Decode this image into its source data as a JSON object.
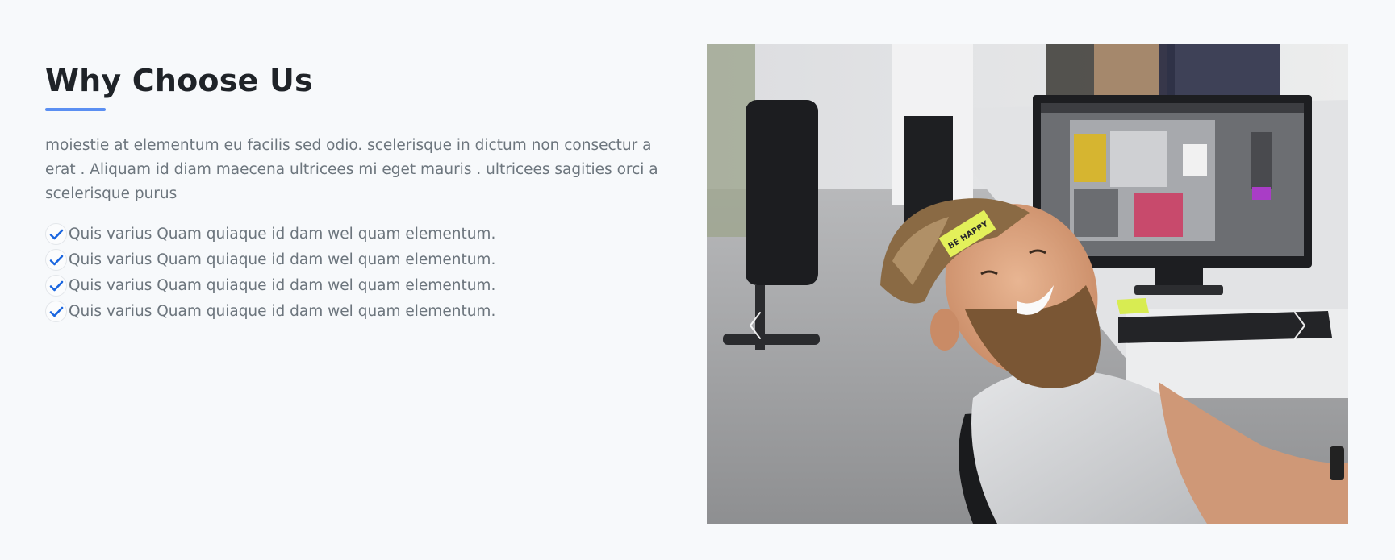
{
  "section": {
    "title": "Why Choose Us",
    "description": "moiestie at elementum eu facilis sed odio. scelerisque in dictum non consectur a erat . Aliquam id diam maecena ultricees mi eget mauris . ultricees sagities orci a scelerisque purus",
    "features": [
      "Quis varius Quam quiaque id dam wel quam elementum.",
      "Quis varius Quam quiaque id dam wel quam elementum.",
      "Quis varius Quam quiaque id dam wel quam elementum.",
      "Quis varius Quam quiaque id dam wel quam elementum."
    ],
    "feature_icon": "check-icon"
  },
  "carousel": {
    "prev_icon": "chevron-left-icon",
    "next_icon": "chevron-right-icon",
    "sticky_note_text": "BE HAPPY"
  },
  "colors": {
    "background": "#f7f9fb",
    "accent": "#5b8ff2",
    "check": "#1a66e0",
    "heading": "#1f2328",
    "body_text": "#6c757d"
  }
}
